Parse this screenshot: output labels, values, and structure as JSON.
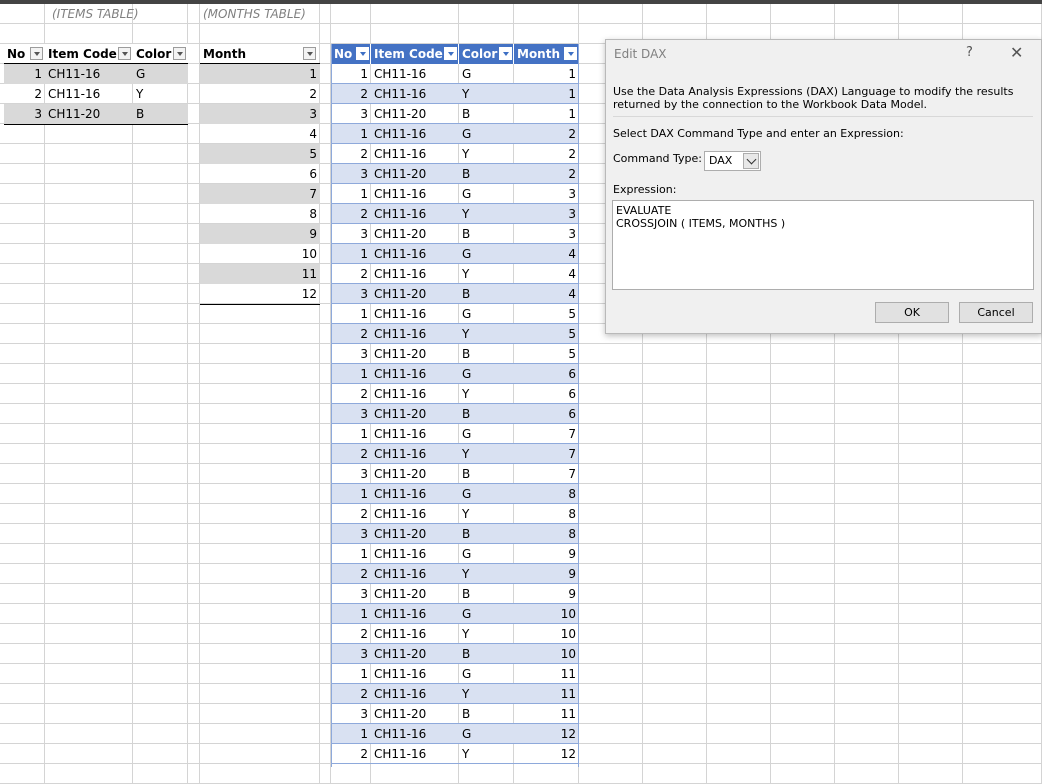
{
  "captions": {
    "items": "(ITEMS TABLE)",
    "months": "(MONTHS TABLE)"
  },
  "items_table": {
    "headers": [
      "No",
      "Item Code",
      "Color"
    ],
    "rows": [
      [
        "1",
        "CH11-16",
        "G"
      ],
      [
        "2",
        "CH11-16",
        "Y"
      ],
      [
        "3",
        "CH11-20",
        "B"
      ]
    ]
  },
  "months_table": {
    "header": "Month",
    "rows": [
      "1",
      "2",
      "3",
      "4",
      "5",
      "6",
      "7",
      "8",
      "9",
      "10",
      "11",
      "12"
    ]
  },
  "result_table": {
    "headers": [
      "No",
      "Item Code",
      "Color",
      "Month"
    ],
    "rows": [
      [
        "1",
        "CH11-16",
        "G",
        "1"
      ],
      [
        "2",
        "CH11-16",
        "Y",
        "1"
      ],
      [
        "3",
        "CH11-20",
        "B",
        "1"
      ],
      [
        "1",
        "CH11-16",
        "G",
        "2"
      ],
      [
        "2",
        "CH11-16",
        "Y",
        "2"
      ],
      [
        "3",
        "CH11-20",
        "B",
        "2"
      ],
      [
        "1",
        "CH11-16",
        "G",
        "3"
      ],
      [
        "2",
        "CH11-16",
        "Y",
        "3"
      ],
      [
        "3",
        "CH11-20",
        "B",
        "3"
      ],
      [
        "1",
        "CH11-16",
        "G",
        "4"
      ],
      [
        "2",
        "CH11-16",
        "Y",
        "4"
      ],
      [
        "3",
        "CH11-20",
        "B",
        "4"
      ],
      [
        "1",
        "CH11-16",
        "G",
        "5"
      ],
      [
        "2",
        "CH11-16",
        "Y",
        "5"
      ],
      [
        "3",
        "CH11-20",
        "B",
        "5"
      ],
      [
        "1",
        "CH11-16",
        "G",
        "6"
      ],
      [
        "2",
        "CH11-16",
        "Y",
        "6"
      ],
      [
        "3",
        "CH11-20",
        "B",
        "6"
      ],
      [
        "1",
        "CH11-16",
        "G",
        "7"
      ],
      [
        "2",
        "CH11-16",
        "Y",
        "7"
      ],
      [
        "3",
        "CH11-20",
        "B",
        "7"
      ],
      [
        "1",
        "CH11-16",
        "G",
        "8"
      ],
      [
        "2",
        "CH11-16",
        "Y",
        "8"
      ],
      [
        "3",
        "CH11-20",
        "B",
        "8"
      ],
      [
        "1",
        "CH11-16",
        "G",
        "9"
      ],
      [
        "2",
        "CH11-16",
        "Y",
        "9"
      ],
      [
        "3",
        "CH11-20",
        "B",
        "9"
      ],
      [
        "1",
        "CH11-16",
        "G",
        "10"
      ],
      [
        "2",
        "CH11-16",
        "Y",
        "10"
      ],
      [
        "3",
        "CH11-20",
        "B",
        "10"
      ],
      [
        "1",
        "CH11-16",
        "G",
        "11"
      ],
      [
        "2",
        "CH11-16",
        "Y",
        "11"
      ],
      [
        "3",
        "CH11-20",
        "B",
        "11"
      ],
      [
        "1",
        "CH11-16",
        "G",
        "12"
      ],
      [
        "2",
        "CH11-16",
        "Y",
        "12"
      ]
    ]
  },
  "dialog": {
    "title": "Edit DAX",
    "help": "?",
    "close": "✕",
    "description": "Use the Data Analysis Expressions (DAX) Language to modify the results returned by the connection to the Workbook Data Model.",
    "instruction": "Select DAX Command Type and enter an Expression:",
    "command_type_label": "Command Type:",
    "command_type_value": "DAX",
    "expression_label": "Expression:",
    "expression": "EVALUATE\nCROSSJOIN ( ITEMS, MONTHS )",
    "ok": "OK",
    "cancel": "Cancel"
  },
  "colors": {
    "items_band": "#d9d9d9",
    "result_header": "#4472c4",
    "result_band": "#d9e1f2"
  },
  "icons": {
    "filter": "filter-dropdown-icon",
    "close": "close-icon",
    "help": "help-icon",
    "dropdown": "chevron-down-icon"
  }
}
